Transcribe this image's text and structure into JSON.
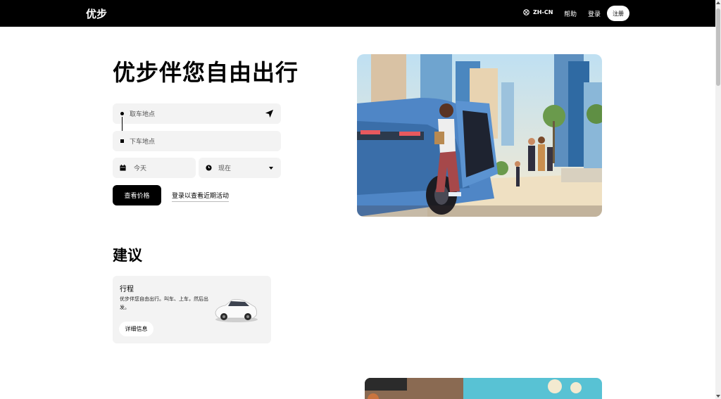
{
  "header": {
    "brand": "优步",
    "language": "ZH-CN",
    "help": "帮助",
    "login": "登录",
    "signup": "注册"
  },
  "hero": {
    "title": "优步伴您自由出行",
    "pickup_placeholder": "取车地点",
    "dropoff_placeholder": "下车地点",
    "date_value": "今天",
    "time_value": "现在",
    "price_button": "查看价格",
    "recent_link": "登录以查看近期活动"
  },
  "suggestions": {
    "title": "建议",
    "cards": [
      {
        "title": "行程",
        "description": "优步伴您自由出行。叫车、上车，然后出发。",
        "button": "详细信息"
      }
    ]
  },
  "icons": {
    "globe": "globe-icon",
    "navigate": "navigation-arrow-icon",
    "calendar": "calendar-icon",
    "clock": "clock-icon",
    "caret": "chevron-down-icon"
  }
}
